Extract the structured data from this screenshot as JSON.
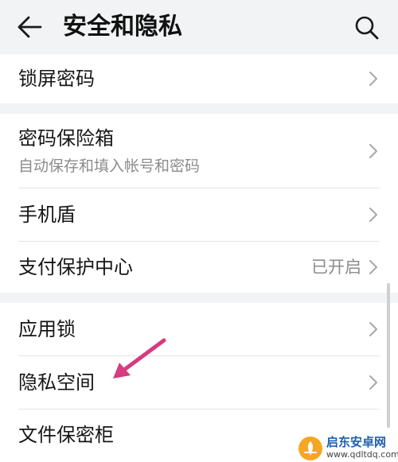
{
  "header": {
    "title": "安全和隐私",
    "back_icon": "back-arrow-icon",
    "search_icon": "search-icon"
  },
  "groups": [
    {
      "items": [
        {
          "label": "锁屏密码"
        }
      ]
    },
    {
      "items": [
        {
          "label": "密码保险箱",
          "subtitle": "自动保存和填入帐号和密码"
        },
        {
          "label": "手机盾"
        },
        {
          "label": "支付保护中心",
          "value": "已开启"
        }
      ]
    },
    {
      "items": [
        {
          "label": "应用锁"
        },
        {
          "label": "隐私空间"
        },
        {
          "label": "文件保密柜"
        }
      ]
    }
  ],
  "annotation": {
    "arrow_color": "#d63c7f"
  },
  "watermark": {
    "text": "启东安卓网",
    "url": "www.qdltdq.com",
    "logo_color": "#f5a623"
  },
  "colors": {
    "background": "#f1f3f5",
    "card": "#ffffff",
    "secondary_text": "#8c8c8c"
  }
}
